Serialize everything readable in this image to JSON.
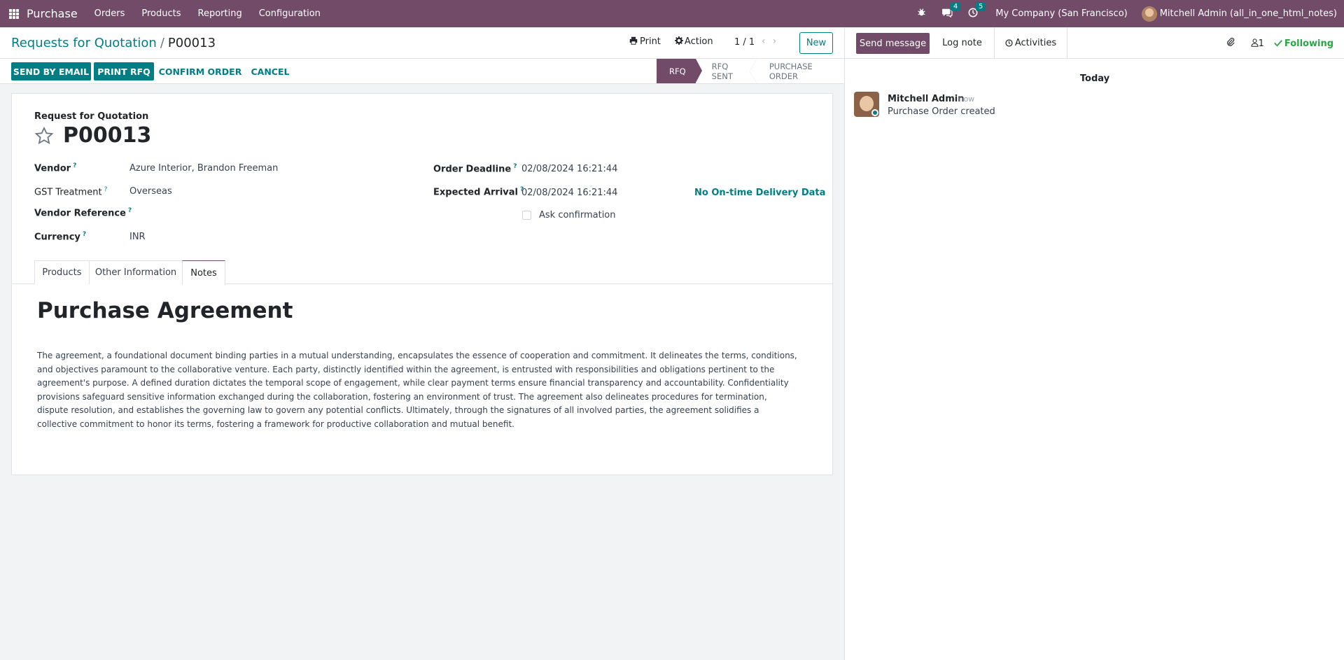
{
  "nav": {
    "app_name": "Purchase",
    "menu": [
      "Orders",
      "Products",
      "Reporting",
      "Configuration"
    ],
    "messages_count": "4",
    "activities_count": "5",
    "company": "My Company (San Francisco)",
    "user": "Mitchell Admin (all_in_one_html_notes)"
  },
  "control": {
    "breadcrumb_parent": "Requests for Quotation",
    "breadcrumb_sep": "/",
    "breadcrumb_current": "P00013",
    "print_label": "Print",
    "action_label": "Action",
    "pager": "1 / 1",
    "new_label": "New"
  },
  "statusbar": {
    "send_email": "SEND BY EMAIL",
    "print_rfq": "PRINT RFQ",
    "confirm": "CONFIRM ORDER",
    "cancel": "CANCEL",
    "stages": [
      "RFQ",
      "RFQ SENT",
      "PURCHASE ORDER"
    ]
  },
  "form": {
    "kind": "Request for Quotation",
    "name": "P00013",
    "vendor_label": "Vendor",
    "vendor_value": "Azure Interior, Brandon Freeman",
    "gst_label": "GST Treatment",
    "gst_value": "Overseas",
    "vendor_ref_label": "Vendor Reference",
    "currency_label": "Currency",
    "currency_value": "INR",
    "deadline_label": "Order Deadline",
    "deadline_value": "02/08/2024 16:21:44",
    "arrival_label": "Expected Arrival",
    "arrival_value": "02/08/2024 16:21:44",
    "ontime": "No On-time Delivery Data",
    "ask_confirmation": "Ask confirmation",
    "tabs": [
      "Products",
      "Other Information",
      "Notes"
    ],
    "notes_title": "Purchase Agreement",
    "notes_body": "The agreement, a foundational document binding parties in a mutual understanding, encapsulates the essence of cooperation and commitment. It delineates the terms, conditions, and objectives paramount to the collaborative venture. Each party, distinctly identified within the agreement, is entrusted with responsibilities and obligations pertinent to the agreement's purpose. A defined duration dictates the temporal scope of engagement, while clear payment terms ensure financial transparency and accountability. Confidentiality provisions safeguard sensitive information exchanged during the collaboration, fostering an environment of trust. The agreement also delineates procedures for termination, dispute resolution, and establishes the governing law to govern any potential conflicts. Ultimately, through the signatures of all involved parties, the agreement solidifies a collective commitment to honor its terms, fostering a framework for productive collaboration and mutual benefit."
  },
  "chatter": {
    "send_message": "Send message",
    "log_note": "Log note",
    "activities": "Activities",
    "followers_count": "1",
    "following": "Following",
    "today": "Today",
    "author": "Mitchell Admin",
    "time": "- now",
    "body": "Purchase Order created"
  },
  "icons": {
    "apps": "apps-grid-icon",
    "bug": "bug-icon",
    "chat": "chat-icon",
    "clock": "clock-icon",
    "print": "print-icon",
    "gear": "gear-icon",
    "star": "star-icon",
    "paperclip": "paperclip-icon",
    "user": "user-icon",
    "check": "check-icon"
  },
  "colors": {
    "brand": "#714b67",
    "accent": "#017e84",
    "following": "#28a745"
  }
}
